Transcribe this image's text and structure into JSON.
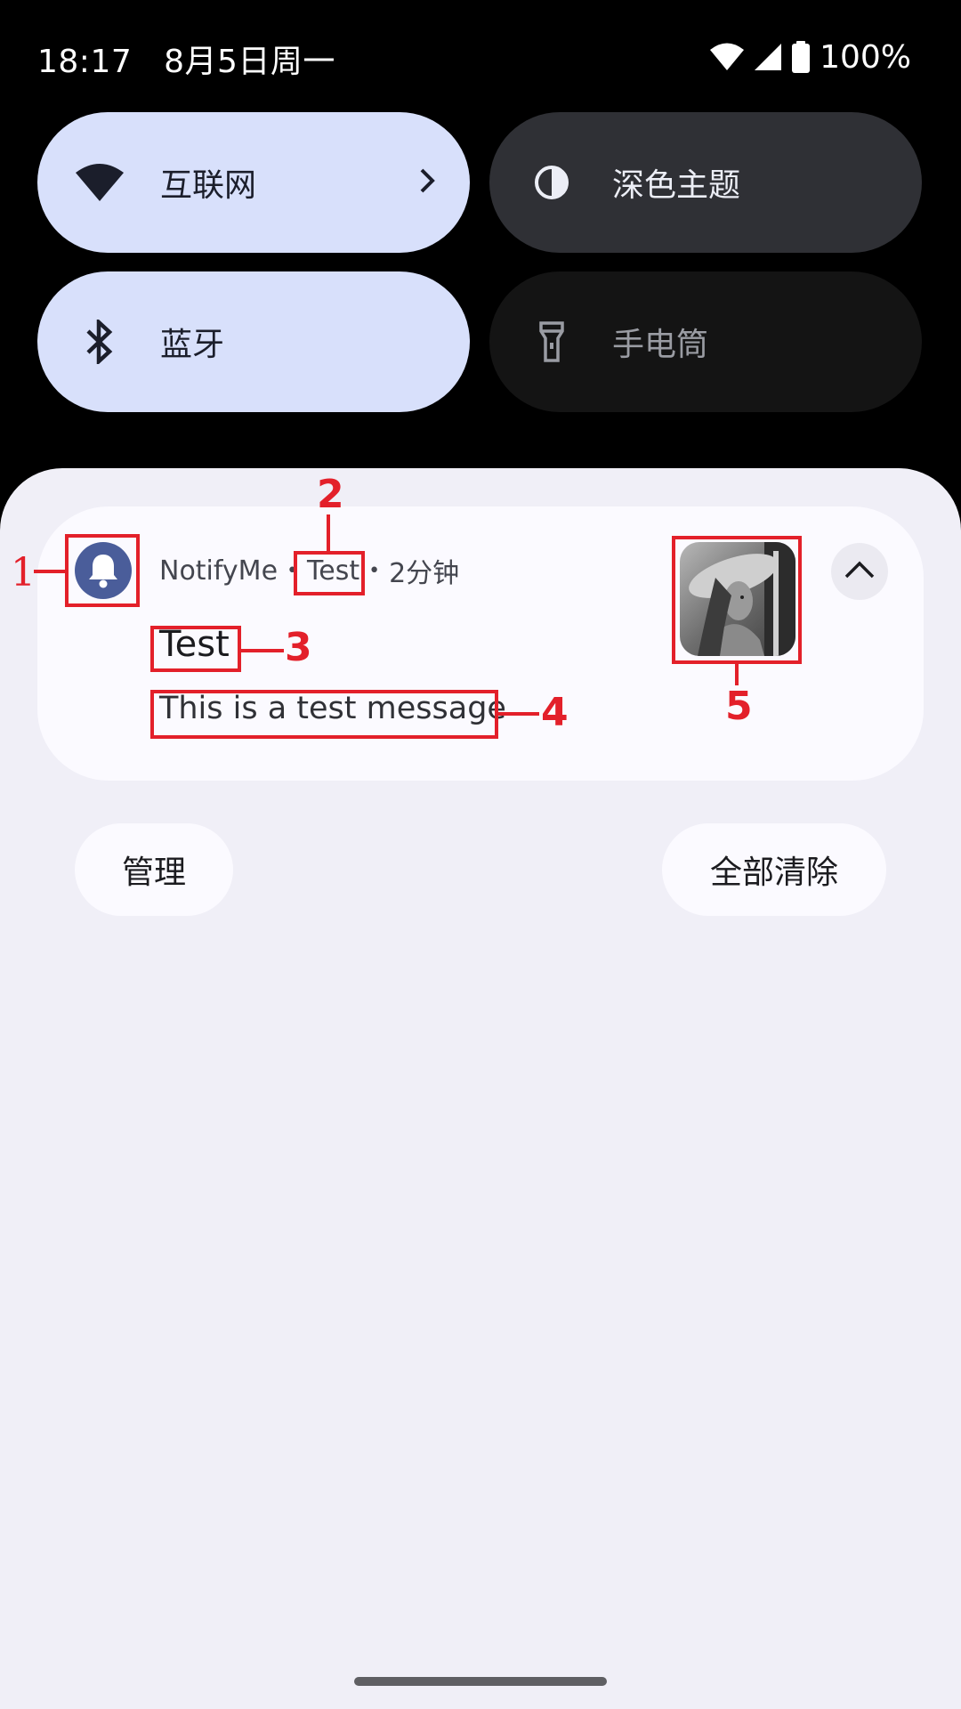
{
  "status_bar": {
    "time": "18:17",
    "date": "8月5日周一",
    "battery": "100%",
    "icons": [
      "wifi-icon",
      "cell-signal-icon",
      "battery-icon"
    ]
  },
  "quick_settings": {
    "tiles": [
      {
        "label": "互联网",
        "icon": "wifi-icon",
        "state": "on"
      },
      {
        "label": "深色主题",
        "icon": "dark-theme-icon",
        "state": "off"
      },
      {
        "label": "蓝牙",
        "icon": "bluetooth-icon",
        "state": "on"
      },
      {
        "label": "手电筒",
        "icon": "flashlight-icon",
        "state": "unavailable"
      }
    ]
  },
  "notification": {
    "app_name": "NotifyMe",
    "channel": "Test",
    "time_ago": "2分钟",
    "title": "Test",
    "message": "This is a test message",
    "icon": "bell-icon",
    "thumbnail": "portrait-photo",
    "expand_icon": "chevron-up-icon"
  },
  "annotations": [
    "1",
    "2",
    "3",
    "4",
    "5"
  ],
  "actions": {
    "manage": "管理",
    "clear_all": "全部清除"
  },
  "colors": {
    "tile_active": "#d8e0fb",
    "tile_inactive": "#2f3035",
    "shade": "#f0eff7",
    "annotation_red": "#e3202a",
    "app_icon": "#4a5d9a"
  }
}
